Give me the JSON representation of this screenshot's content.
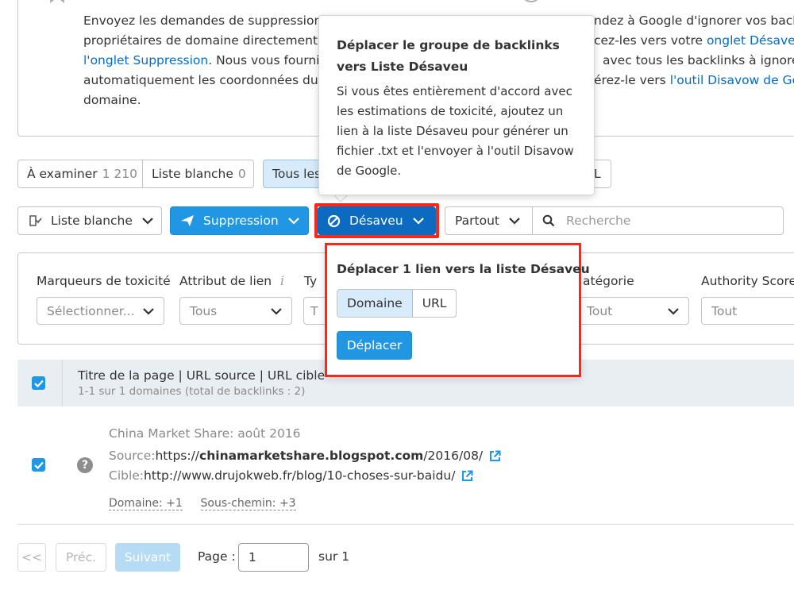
{
  "info_left": {
    "lines": [
      "Envoyez les demandes de suppression d",
      "propriétaires de domaine directement",
      "l'onglet Suppression",
      ". Nous vous fournir",
      "automatiquement les coordonnées du",
      "domaine."
    ]
  },
  "info_right": {
    "line1": "ndez à Google d'ignorer vos backl",
    "line2_pre": "cez-les vers votre ",
    "line2_link": "onglet Désaveu",
    "line3": "avec tous les backlinks à ignorer",
    "line4_pre": "érez-le vers ",
    "line4_link": "l'outil Disavow de Goo"
  },
  "tabs": [
    {
      "label": "À examiner",
      "count": "1 210"
    },
    {
      "label": "Liste blanche",
      "count": "0"
    },
    {
      "label": "Tous les",
      "count": ""
    },
    {
      "label": "L",
      "count": ""
    }
  ],
  "toolbar": {
    "whitelist": "Liste blanche",
    "removal": "Suppression",
    "disavow": "Désaveu",
    "scope": "Partout",
    "search_placeholder": "Recherche"
  },
  "tooltip": {
    "title": "Déplacer le groupe de backlinks vers Liste Désaveu",
    "body": "Si vous êtes entièrement d'accord avec les estimations de toxicité, ajoutez un lien à la liste Désaveu pour générer un fichier .txt et l'envoyer à l'outil Disavow de Google."
  },
  "filters": [
    {
      "label": "Marqueurs de toxicité",
      "value": "Sélectionner..."
    },
    {
      "label": "Attribut de lien",
      "value": "Tous"
    },
    {
      "label": "Ty",
      "value": "T"
    },
    {
      "label": "atégorie",
      "value": "Tout"
    },
    {
      "label": "Authority Score",
      "value": "Tout"
    }
  ],
  "popup": {
    "title": "Déplacer 1 lien vers la liste Désaveu",
    "option_domain": "Domaine",
    "option_url": "URL",
    "move_button": "Déplacer"
  },
  "table": {
    "header_title": "Titre de la page | URL source | URL cible",
    "header_sub": "1-1 sur 1 domaines (total de backlinks : 2)",
    "row": {
      "page_title": "China Market Share: août 2016",
      "source_label": "Source: ",
      "source_prefix": "https://",
      "source_domain": "chinamarketshare.blogspot.com",
      "source_path": "/2016/08/",
      "target_label": "Cible: ",
      "target_url": "http://www.drujokweb.fr/blog/10-choses-sur-baidu/",
      "domain_tag": "Domaine: +1",
      "subpath_tag": "Sous-chemin: +3"
    }
  },
  "pagination": {
    "first": "<<",
    "prev": "Préc.",
    "next": "Suivant",
    "page_label": "Page :",
    "page_value": "1",
    "of_label": "sur 1"
  },
  "colors": {
    "primary": "#2196e2",
    "primary_dark": "#0c6ac0",
    "highlight": "#ff2618",
    "selected_bg": "#d7ebfb"
  }
}
